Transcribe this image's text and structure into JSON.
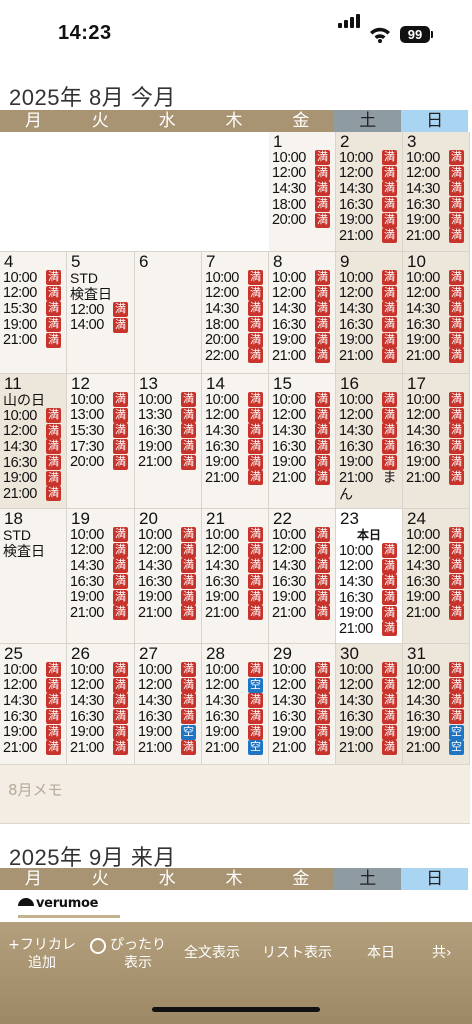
{
  "status": {
    "time": "14:23",
    "battery": "99"
  },
  "weekdays": [
    "月",
    "火",
    "水",
    "木",
    "金",
    "土",
    "日"
  ],
  "aug": {
    "title": "2025年 8月 今月",
    "memo_placeholder": "8月メモ"
  },
  "sep": {
    "title": "2025年 9月 来月"
  },
  "brand": "verumoe",
  "toolbar": {
    "free_add": "+フリカレ\n追加",
    "fit": "ぴったり\n表示",
    "full": "全文表示",
    "list": "リスト表示",
    "today": "本日",
    "share": "共"
  },
  "colors": {
    "full": "#c8342c",
    "open": "#1f74c4",
    "header": "#a89472",
    "sat": "#8f9ba3",
    "sun": "#a9d4f2"
  },
  "calendar": [
    [
      null,
      null,
      null,
      null,
      {
        "d": "1",
        "s": [
          [
            "10:00",
            "満"
          ],
          [
            "12:00",
            "満"
          ],
          [
            "14:30",
            "満"
          ],
          [
            "18:00",
            "満"
          ],
          [
            "20:00",
            "満"
          ]
        ]
      },
      {
        "d": "2",
        "s": [
          [
            "10:00",
            "満"
          ],
          [
            "12:00",
            "満"
          ],
          [
            "14:30",
            "満"
          ],
          [
            "16:30",
            "満"
          ],
          [
            "19:00",
            "満"
          ],
          [
            "21:00",
            "満"
          ]
        ]
      },
      {
        "d": "3",
        "s": [
          [
            "10:00",
            "満"
          ],
          [
            "12:00",
            "満"
          ],
          [
            "14:30",
            "満"
          ],
          [
            "16:30",
            "満"
          ],
          [
            "19:00",
            "満"
          ],
          [
            "21:00",
            "満"
          ]
        ]
      }
    ],
    [
      {
        "d": "4",
        "s": [
          [
            "10:00",
            "満"
          ],
          [
            "12:00",
            "満"
          ],
          [
            "15:30",
            "満"
          ],
          [
            "19:00",
            "満"
          ],
          [
            "21:00",
            "満"
          ]
        ]
      },
      {
        "d": "5",
        "notes": [
          "STD",
          "検査日"
        ],
        "s": [
          [
            "12:00",
            "満"
          ],
          [
            "14:00",
            "満"
          ]
        ]
      },
      {
        "d": "6",
        "s": []
      },
      {
        "d": "7",
        "s": [
          [
            "10:00",
            "満"
          ],
          [
            "12:00",
            "満"
          ],
          [
            "14:30",
            "満"
          ],
          [
            "18:00",
            "満"
          ],
          [
            "20:00",
            "満"
          ],
          [
            "22:00",
            "満"
          ]
        ]
      },
      {
        "d": "8",
        "s": [
          [
            "10:00",
            "満"
          ],
          [
            "12:00",
            "満"
          ],
          [
            "14:30",
            "満"
          ],
          [
            "16:30",
            "満"
          ],
          [
            "19:00",
            "満"
          ],
          [
            "21:00",
            "満"
          ]
        ]
      },
      {
        "d": "9",
        "s": [
          [
            "10:00",
            "満"
          ],
          [
            "12:00",
            "満"
          ],
          [
            "14:30",
            "満"
          ],
          [
            "16:30",
            "満"
          ],
          [
            "19:00",
            "満"
          ],
          [
            "21:00",
            "満"
          ]
        ]
      },
      {
        "d": "10",
        "s": [
          [
            "10:00",
            "満"
          ],
          [
            "12:00",
            "満"
          ],
          [
            "14:30",
            "満"
          ],
          [
            "16:30",
            "満"
          ],
          [
            "19:00",
            "満"
          ],
          [
            "21:00",
            "満"
          ]
        ]
      }
    ],
    [
      {
        "d": "11",
        "notes": [
          "山の日"
        ],
        "s": [
          [
            "10:00",
            "満"
          ],
          [
            "12:00",
            "満"
          ],
          [
            "14:30",
            "満"
          ],
          [
            "16:30",
            "満"
          ],
          [
            "19:00",
            "満"
          ],
          [
            "21:00",
            "満"
          ]
        ]
      },
      {
        "d": "12",
        "s": [
          [
            "10:00",
            "満"
          ],
          [
            "13:00",
            "満"
          ],
          [
            "15:30",
            "満"
          ],
          [
            "17:30",
            "満"
          ],
          [
            "20:00",
            "満"
          ]
        ]
      },
      {
        "d": "13",
        "s": [
          [
            "10:00",
            "満"
          ],
          [
            "13:30",
            "満"
          ],
          [
            "16:30",
            "満"
          ],
          [
            "19:00",
            "満"
          ],
          [
            "21:00",
            "満"
          ]
        ]
      },
      {
        "d": "14",
        "s": [
          [
            "10:00",
            "満"
          ],
          [
            "12:00",
            "満"
          ],
          [
            "14:30",
            "満"
          ],
          [
            "16:30",
            "満"
          ],
          [
            "19:00",
            "満"
          ],
          [
            "21:00",
            "満"
          ]
        ]
      },
      {
        "d": "15",
        "s": [
          [
            "10:00",
            "満"
          ],
          [
            "12:00",
            "満"
          ],
          [
            "14:30",
            "満"
          ],
          [
            "16:30",
            "満"
          ],
          [
            "19:00",
            "満"
          ],
          [
            "21:00",
            "満"
          ]
        ]
      },
      {
        "d": "16",
        "s": [
          [
            "10:00",
            "満"
          ],
          [
            "12:00",
            "満"
          ],
          [
            "14:30",
            "満"
          ],
          [
            "16:30",
            "満"
          ],
          [
            "19:00",
            "満"
          ],
          [
            "21:00",
            "ま"
          ]
        ],
        "trail": "ん"
      },
      {
        "d": "17",
        "s": [
          [
            "10:00",
            "満"
          ],
          [
            "12:00",
            "満"
          ],
          [
            "14:30",
            "満"
          ],
          [
            "16:30",
            "満"
          ],
          [
            "19:00",
            "満"
          ],
          [
            "21:00",
            "満"
          ]
        ]
      }
    ],
    [
      {
        "d": "18",
        "notes": [
          "STD",
          "検査日"
        ],
        "s": []
      },
      {
        "d": "19",
        "s": [
          [
            "10:00",
            "満"
          ],
          [
            "12:00",
            "満"
          ],
          [
            "14:30",
            "満"
          ],
          [
            "16:30",
            "満"
          ],
          [
            "19:00",
            "満"
          ],
          [
            "21:00",
            "満"
          ]
        ]
      },
      {
        "d": "20",
        "s": [
          [
            "10:00",
            "満"
          ],
          [
            "12:00",
            "満"
          ],
          [
            "14:30",
            "満"
          ],
          [
            "16:30",
            "満"
          ],
          [
            "19:00",
            "満"
          ],
          [
            "21:00",
            "満"
          ]
        ]
      },
      {
        "d": "21",
        "s": [
          [
            "10:00",
            "満"
          ],
          [
            "12:00",
            "満"
          ],
          [
            "14:30",
            "満"
          ],
          [
            "16:30",
            "満"
          ],
          [
            "19:00",
            "満"
          ],
          [
            "21:00",
            "満"
          ]
        ]
      },
      {
        "d": "22",
        "s": [
          [
            "10:00",
            "満"
          ],
          [
            "12:00",
            "満"
          ],
          [
            "14:30",
            "満"
          ],
          [
            "16:30",
            "満"
          ],
          [
            "19:00",
            "満"
          ],
          [
            "21:00",
            "満"
          ]
        ]
      },
      {
        "d": "23",
        "today": "本日",
        "s": [
          [
            "10:00",
            "満"
          ],
          [
            "12:00",
            "満"
          ],
          [
            "14:30",
            "満"
          ],
          [
            "16:30",
            "満"
          ],
          [
            "19:00",
            "満"
          ],
          [
            "21:00",
            "満"
          ]
        ]
      },
      {
        "d": "24",
        "s": [
          [
            "10:00",
            "満"
          ],
          [
            "12:00",
            "満"
          ],
          [
            "14:30",
            "満"
          ],
          [
            "16:30",
            "満"
          ],
          [
            "19:00",
            "満"
          ],
          [
            "21:00",
            "満"
          ]
        ]
      }
    ],
    [
      {
        "d": "25",
        "s": [
          [
            "10:00",
            "満"
          ],
          [
            "12:00",
            "満"
          ],
          [
            "14:30",
            "満"
          ],
          [
            "16:30",
            "満"
          ],
          [
            "19:00",
            "満"
          ],
          [
            "21:00",
            "満"
          ]
        ]
      },
      {
        "d": "26",
        "s": [
          [
            "10:00",
            "満"
          ],
          [
            "12:00",
            "満"
          ],
          [
            "14:30",
            "満"
          ],
          [
            "16:30",
            "満"
          ],
          [
            "19:00",
            "満"
          ],
          [
            "21:00",
            "満"
          ]
        ]
      },
      {
        "d": "27",
        "s": [
          [
            "10:00",
            "満"
          ],
          [
            "12:00",
            "満"
          ],
          [
            "14:30",
            "満"
          ],
          [
            "16:30",
            "満"
          ],
          [
            "19:00",
            "空"
          ],
          [
            "21:00",
            "満"
          ]
        ]
      },
      {
        "d": "28",
        "s": [
          [
            "10:00",
            "満"
          ],
          [
            "12:00",
            "空"
          ],
          [
            "14:30",
            "満"
          ],
          [
            "16:30",
            "満"
          ],
          [
            "19:00",
            "満"
          ],
          [
            "21:00",
            "空"
          ]
        ]
      },
      {
        "d": "29",
        "s": [
          [
            "10:00",
            "満"
          ],
          [
            "12:00",
            "満"
          ],
          [
            "14:30",
            "満"
          ],
          [
            "16:30",
            "満"
          ],
          [
            "19:00",
            "満"
          ],
          [
            "21:00",
            "満"
          ]
        ]
      },
      {
        "d": "30",
        "s": [
          [
            "10:00",
            "満"
          ],
          [
            "12:00",
            "満"
          ],
          [
            "14:30",
            "満"
          ],
          [
            "16:30",
            "満"
          ],
          [
            "19:00",
            "満"
          ],
          [
            "21:00",
            "満"
          ]
        ]
      },
      {
        "d": "31",
        "s": [
          [
            "10:00",
            "満"
          ],
          [
            "12:00",
            "満"
          ],
          [
            "14:30",
            "満"
          ],
          [
            "16:30",
            "満"
          ],
          [
            "19:00",
            "空"
          ],
          [
            "21:00",
            "空"
          ]
        ]
      }
    ]
  ]
}
